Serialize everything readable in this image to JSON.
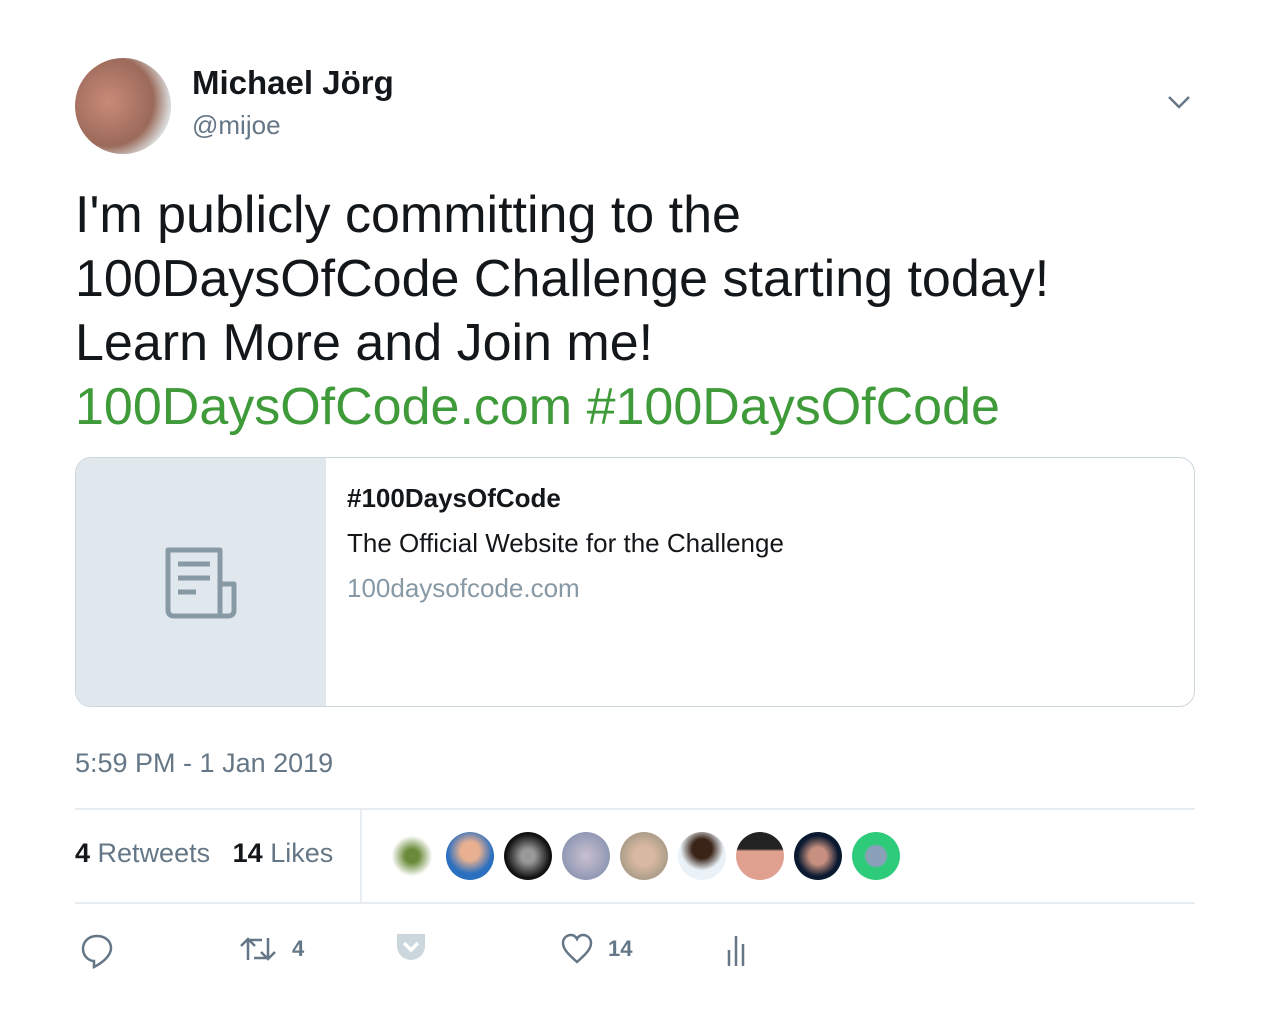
{
  "author": {
    "name": "Michael Jörg",
    "handle": "@mijoe"
  },
  "tweet": {
    "lines": [
      "I'm publicly committing to the",
      "100DaysOfCode Challenge starting today!",
      "Learn More and Join me!"
    ],
    "link": "100DaysOfCode.com",
    "hashtag": "#100DaysOfCode"
  },
  "card": {
    "title": "#100DaysOfCode",
    "description": "The Official Website for the Challenge",
    "url": "100daysofcode.com"
  },
  "timestamp": "5:59 PM - 1 Jan 2019",
  "stats": {
    "retweets_count": "4",
    "retweets_label": "Retweets",
    "likes_count": "14",
    "likes_label": "Likes"
  },
  "actions": {
    "retweet_count": "4",
    "like_count": "14"
  },
  "colors": {
    "link": "#3f9a3a",
    "muted": "#657786"
  }
}
